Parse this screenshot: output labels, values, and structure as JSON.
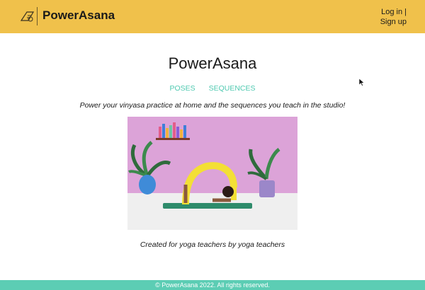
{
  "header": {
    "brand": "PowerAsana",
    "login_label": "Log in |",
    "signup_label": "Sign up"
  },
  "main": {
    "title": "PowerAsana",
    "nav": [
      "POSES",
      "SEQUENCES"
    ],
    "tagline": "Power your vinyasa practice at home and the sequences you teach in the studio!",
    "caption": "Created for yoga teachers by yoga teachers"
  },
  "footer": {
    "text": "© PowerAsana 2022. All rights reserved."
  },
  "colors": {
    "header_bg": "#f0c14b",
    "accent": "#4ec9b0",
    "footer_bg": "#5ccdb4"
  },
  "icons": [
    "yoga-mat-logo-icon",
    "pointer-cursor-icon"
  ]
}
